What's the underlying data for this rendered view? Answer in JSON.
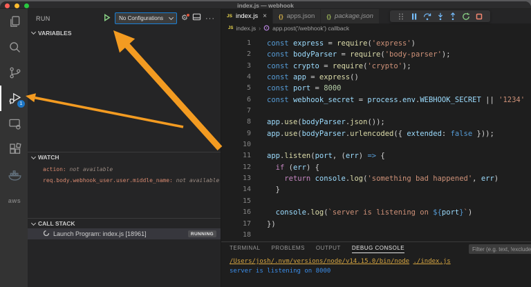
{
  "window": {
    "title": "index.js — webhook"
  },
  "activity_bar": {
    "icons": [
      "files",
      "search",
      "source-control",
      "run-and-debug",
      "remote-explorer",
      "extensions",
      "docker",
      "aws"
    ],
    "active": "run-and-debug",
    "debug_badge": "1",
    "aws_label": "aws"
  },
  "sidebar": {
    "run_label": "RUN",
    "config_dropdown_value": "No Configurations",
    "variables_header": "VARIABLES",
    "watch_header": "WATCH",
    "call_stack_header": "CALL STACK",
    "watch_items": [
      {
        "name": "action:",
        "value": "not available"
      },
      {
        "name": "req.body.webhook_user.user.middle_name:",
        "value": "not available"
      }
    ],
    "call_stack_row": {
      "label": "Launch Program: index.js [18961]",
      "status": "RUNNING"
    },
    "more_actions": "⋯"
  },
  "editor": {
    "tabs": [
      {
        "label": "index.js",
        "icon": "js",
        "active": true
      },
      {
        "label": "apps.json",
        "icon": "json-braces",
        "active": false
      },
      {
        "label": "package.json",
        "icon": "json-braces",
        "active": false,
        "preview": true
      }
    ],
    "breadcrumb": {
      "file": "index.js",
      "symbol": "app.post('/webhook') callback"
    },
    "code_lines": [
      [
        [
          "const ",
          "k"
        ],
        [
          "express",
          "v"
        ],
        [
          " = ",
          "p"
        ],
        [
          "require",
          "f"
        ],
        [
          "(",
          "p"
        ],
        [
          "'express'",
          "s"
        ],
        [
          ")",
          "p"
        ]
      ],
      [
        [
          "const ",
          "k"
        ],
        [
          "bodyParser",
          "v"
        ],
        [
          " = ",
          "p"
        ],
        [
          "require",
          "f"
        ],
        [
          "(",
          "p"
        ],
        [
          "'body-parser'",
          "s"
        ],
        [
          ");",
          "p"
        ]
      ],
      [
        [
          "const ",
          "k"
        ],
        [
          "crypto",
          "v"
        ],
        [
          " = ",
          "p"
        ],
        [
          "require",
          "f"
        ],
        [
          "(",
          "p"
        ],
        [
          "'crypto'",
          "s"
        ],
        [
          ");",
          "p"
        ]
      ],
      [
        [
          "const ",
          "k"
        ],
        [
          "app",
          "v"
        ],
        [
          " = ",
          "p"
        ],
        [
          "express",
          "f"
        ],
        [
          "()",
          "p"
        ]
      ],
      [
        [
          "const ",
          "k"
        ],
        [
          "port",
          "v"
        ],
        [
          " = ",
          "p"
        ],
        [
          "8000",
          "n"
        ]
      ],
      [
        [
          "const ",
          "k"
        ],
        [
          "webhook_secret",
          "v"
        ],
        [
          " = ",
          "p"
        ],
        [
          "process",
          "v"
        ],
        [
          ".",
          "p"
        ],
        [
          "env",
          "v"
        ],
        [
          ".",
          "p"
        ],
        [
          "WEBHOOK_SECRET",
          "v"
        ],
        [
          " || ",
          "p"
        ],
        [
          "'1234'",
          "s"
        ]
      ],
      [],
      [
        [
          "app",
          "v"
        ],
        [
          ".",
          "p"
        ],
        [
          "use",
          "f"
        ],
        [
          "(",
          "p"
        ],
        [
          "bodyParser",
          "v"
        ],
        [
          ".",
          "p"
        ],
        [
          "json",
          "f"
        ],
        [
          "());",
          "p"
        ]
      ],
      [
        [
          "app",
          "v"
        ],
        [
          ".",
          "p"
        ],
        [
          "use",
          "f"
        ],
        [
          "(",
          "p"
        ],
        [
          "bodyParser",
          "v"
        ],
        [
          ".",
          "p"
        ],
        [
          "urlencoded",
          "f"
        ],
        [
          "({ ",
          "p"
        ],
        [
          "extended",
          "v"
        ],
        [
          ": ",
          "p"
        ],
        [
          "false",
          "k"
        ],
        [
          " }));",
          "p"
        ]
      ],
      [],
      [
        [
          "app",
          "v"
        ],
        [
          ".",
          "p"
        ],
        [
          "listen",
          "f"
        ],
        [
          "(",
          "p"
        ],
        [
          "port",
          "v"
        ],
        [
          ", (",
          "p"
        ],
        [
          "err",
          "v"
        ],
        [
          ") ",
          "p"
        ],
        [
          "=>",
          "k"
        ],
        [
          " {",
          "p"
        ]
      ],
      [
        [
          "  ",
          "p"
        ],
        [
          "if",
          "c"
        ],
        [
          " (",
          "p"
        ],
        [
          "err",
          "v"
        ],
        [
          ") {",
          "p"
        ]
      ],
      [
        [
          "    ",
          "p"
        ],
        [
          "return",
          "c"
        ],
        [
          " ",
          "p"
        ],
        [
          "console",
          "v"
        ],
        [
          ".",
          "p"
        ],
        [
          "log",
          "f"
        ],
        [
          "(",
          "p"
        ],
        [
          "'something bad happened'",
          "s"
        ],
        [
          ", ",
          "p"
        ],
        [
          "err",
          "v"
        ],
        [
          ")",
          "p"
        ]
      ],
      [
        [
          "  }",
          "p"
        ]
      ],
      [],
      [
        [
          "  ",
          "p"
        ],
        [
          "console",
          "v"
        ],
        [
          ".",
          "p"
        ],
        [
          "log",
          "f"
        ],
        [
          "(",
          "p"
        ],
        [
          "`server is listening on ",
          "s"
        ],
        [
          "${",
          "k"
        ],
        [
          "port",
          "v"
        ],
        [
          "}",
          "k"
        ],
        [
          "`",
          "s"
        ],
        [
          ")",
          "p"
        ]
      ],
      [
        [
          "})",
          "p"
        ]
      ],
      []
    ]
  },
  "panel": {
    "tabs": [
      "TERMINAL",
      "PROBLEMS",
      "OUTPUT",
      "DEBUG CONSOLE"
    ],
    "active_tab": "DEBUG CONSOLE",
    "filter_placeholder": "Filter (e.g. text, !exclude)",
    "console": {
      "command_path": "/Users/josh/.nvm/versions/node/v14.15.0/bin/node",
      "command_arg": "./index.js",
      "stdout": "server is listening on 8000"
    }
  },
  "colors": {
    "arrow_orange": "#f39b21",
    "accent_blue": "#007acc",
    "focus_border": "#1a81d8",
    "stdout_blue": "#3b8eea",
    "link_gold": "#d7a641"
  }
}
